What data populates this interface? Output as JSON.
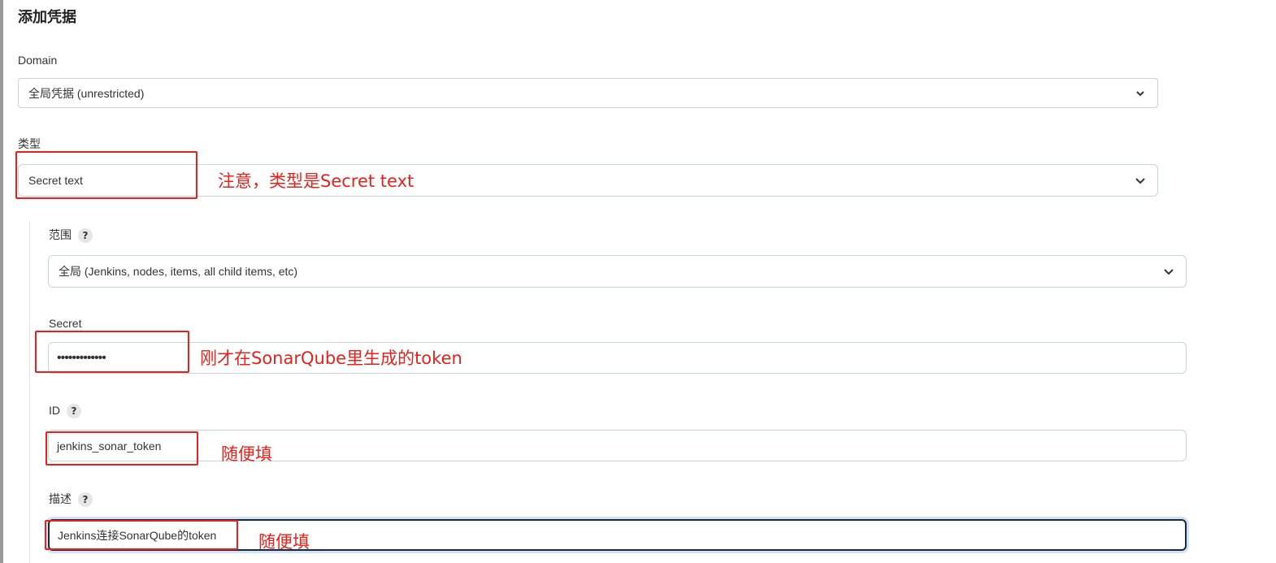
{
  "form": {
    "title": "添加凭据",
    "domain": {
      "label": "Domain",
      "value": "全局凭据 (unrestricted)"
    },
    "kind": {
      "label": "类型",
      "value": "Secret text"
    },
    "scope": {
      "label": "范围",
      "value": "全局 (Jenkins, nodes, items, all child items, etc)"
    },
    "secret": {
      "label": "Secret",
      "masked_value": "•••••••••••••"
    },
    "id": {
      "label": "ID",
      "value": "jenkins_sonar_token"
    },
    "description": {
      "label": "描述",
      "value": "Jenkins连接SonarQube的token"
    },
    "help_badge": "?"
  },
  "annotations": {
    "kind_note": "注意，类型是Secret text",
    "secret_note": "刚才在SonarQube里生成的token",
    "id_note": "随便填",
    "description_note": "随便填"
  },
  "colors": {
    "annotation_red": "#e8211c",
    "focus_ring": "#cfe3f5"
  },
  "icons": {
    "dropdown": "chevron-down-icon"
  }
}
